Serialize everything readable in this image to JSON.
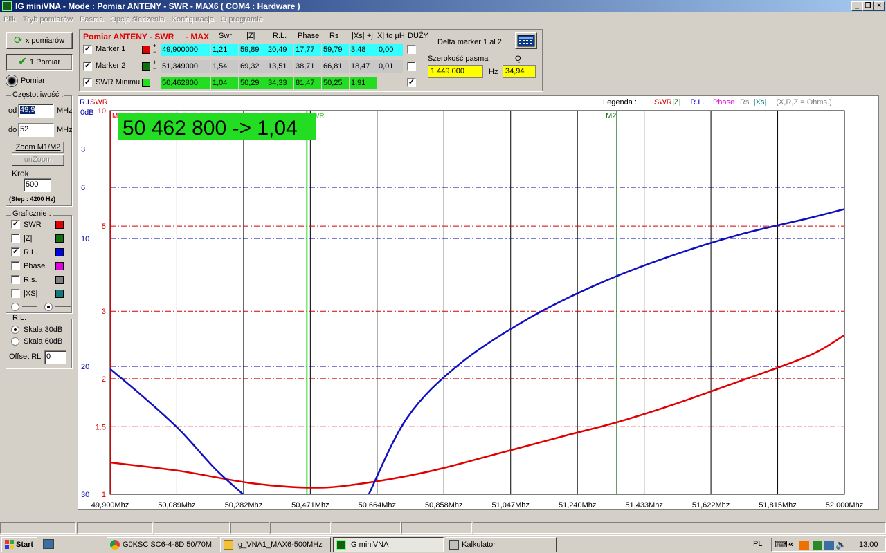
{
  "window": {
    "title": "IG miniVNA - Mode : Pomiar ANTENY - SWR    - MAX6 ( COM4 : Hardware )"
  },
  "menu": [
    "Plik",
    "Tryb pomiarów",
    "Pasma",
    "Opcje śledzenia",
    "Konfiguracja",
    "O programie"
  ],
  "left": {
    "btn_multi": "x pomiarów",
    "btn_single": "1 Pomiar",
    "pomiar_label": "Pomiar",
    "freq_group": "Częstotliwość :",
    "od_label": "od",
    "od_value": "49,9",
    "do_label": "do",
    "do_value": "52",
    "mhz": "MHz",
    "zoom": "Zoom M1/M2",
    "unzoom": "unZoom",
    "krok_label": "Krok",
    "krok_value": "500",
    "step_note": "(Step : 4200 Hz)",
    "graf_group": "Graficznie :",
    "traces": [
      {
        "label": "SWR",
        "checked": true,
        "color": "#e00000"
      },
      {
        "label": "|Z|",
        "checked": false,
        "color": "#107010"
      },
      {
        "label": "R.L.",
        "checked": true,
        "color": "#0000e0"
      },
      {
        "label": "Phase",
        "checked": false,
        "color": "#e000e0"
      },
      {
        "label": "R.s.",
        "checked": false,
        "color": "#808080"
      },
      {
        "label": "|XS|",
        "checked": false,
        "color": "#107878"
      }
    ],
    "rl_group": "R.L.",
    "scale30": "Skala 30dB",
    "scale60": "Skala 60dB",
    "offset_label": "Offset RL",
    "offset_value": "0"
  },
  "table": {
    "title": "Pomiar ANTENY - SWR",
    "max": "- MAX",
    "headers": [
      "Swr",
      "|Z|",
      "R.L.",
      "Phase",
      "Rs",
      "|Xs|",
      "+j",
      "X| to µH",
      "DUŻY"
    ],
    "rows": [
      {
        "name": "Marker 1",
        "color": "#e00000",
        "bg": "#33ffff",
        "values": [
          "49,900000",
          "1,21",
          "59,89",
          "20,49",
          "17,77",
          "59,79",
          "3,48",
          "0,00"
        ],
        "big": false
      },
      {
        "name": "Marker 2",
        "color": "#107010",
        "bg": "#c8c8c8",
        "values": [
          "51,349000",
          "1,54",
          "69,32",
          "13,51",
          "38,71",
          "66,81",
          "18,47",
          "0,01"
        ],
        "big": false
      },
      {
        "name": "SWR Minimu",
        "color": "#22dd22",
        "bg": "#22dd22",
        "values": [
          "50,462800",
          "1,04",
          "50,29",
          "34,33",
          "81,47",
          "50,25",
          "1,91"
        ],
        "big": true
      }
    ],
    "delta_label": "Delta marker 1 al 2",
    "bw_label": "Szerokość pasma",
    "q_label": "Q",
    "bw_value": "1 449 000",
    "hz": "Hz",
    "q_value": "34,94"
  },
  "chart": {
    "rl_title": "R.L.",
    "swr_title": "SWR",
    "legend_label": "Legenda :",
    "legend": [
      {
        "text": "SWR",
        "color": "#e00000"
      },
      {
        "text": "|Z|",
        "color": "#107010"
      },
      {
        "text": "R.L.",
        "color": "#0000c0"
      },
      {
        "text": "Phase",
        "color": "#e000e0"
      },
      {
        "text": "Rs",
        "color": "#808080"
      },
      {
        "text": "|Xs|",
        "color": "#108080"
      },
      {
        "text": "(X,R,Z = Ohms.)",
        "color": "#808080"
      }
    ],
    "readout": "50 462 800  -> 1,04",
    "marker_m1": "M",
    "marker_m2": "M2",
    "marker_min": "SWR",
    "marker_min_sub": "ni",
    "colors": {
      "swr": "#e00000",
      "rl": "#1010c0",
      "minmarker": "#33dd33",
      "m2": "#107010"
    }
  },
  "chart_data": {
    "type": "line",
    "xlabel": "",
    "x_ticks": [
      "49,900Mhz",
      "50,089Mhz",
      "50,282Mhz",
      "50,471Mhz",
      "50,664Mhz",
      "50,858Mhz",
      "51,047Mhz",
      "51,240Mhz",
      "51,433Mhz",
      "51,622Mhz",
      "51,815Mhz",
      "52,000Mhz"
    ],
    "xlim": [
      49.9,
      52.0
    ],
    "swr_axis": {
      "ticks": [
        "10",
        "5",
        "3",
        "2",
        "1.5",
        "1"
      ]
    },
    "rl_axis": {
      "unit": "0dB",
      "ticks": [
        "3",
        "6",
        "10",
        "20",
        "30"
      ],
      "range": [
        0,
        30
      ]
    },
    "series": [
      {
        "name": "SWR",
        "x": [
          49.9,
          50.1,
          50.3,
          50.471,
          50.6,
          50.8,
          51.0,
          51.2,
          51.349,
          51.5,
          51.7,
          51.9,
          52.0
        ],
        "y": [
          1.21,
          1.15,
          1.07,
          1.04,
          1.06,
          1.14,
          1.27,
          1.42,
          1.54,
          1.7,
          1.97,
          2.3,
          2.6
        ]
      },
      {
        "name": "R.L.",
        "x": [
          49.9,
          50.0,
          50.1,
          50.2,
          50.28,
          50.64,
          50.75,
          50.9,
          51.1,
          51.3,
          51.5,
          51.7,
          51.9,
          52.0
        ],
        "y": [
          20.2,
          22.5,
          25.0,
          28.0,
          30.0,
          30.0,
          24.0,
          19.8,
          16.2,
          13.5,
          11.4,
          9.7,
          8.4,
          7.7
        ]
      }
    ]
  },
  "statusbar": [
    "",
    "",
    "",
    "",
    "",
    "",
    ""
  ],
  "taskbar": {
    "start": "Start",
    "tasks": [
      "G0KSC SC6-4-8D 50/70M...",
      "Ig_VNA1_MAX6-500MHz",
      "IG miniVNA",
      "Kalkulator"
    ],
    "lang": "PL",
    "time": "13:00"
  }
}
